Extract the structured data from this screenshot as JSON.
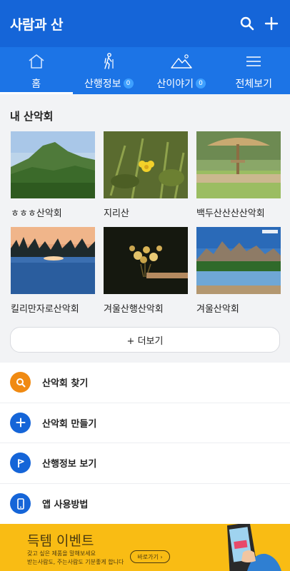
{
  "header": {
    "title": "사람과 산",
    "search_icon": "search-icon",
    "add_icon": "plus-icon"
  },
  "tabs": [
    {
      "label": "홈",
      "icon": "home-icon",
      "active": true
    },
    {
      "label": "산행정보",
      "badge": "0",
      "icon": "hiker-icon"
    },
    {
      "label": "산이야기",
      "badge": "0",
      "icon": "mountain-icon"
    },
    {
      "label": "전체보기",
      "icon": "menu-icon"
    }
  ],
  "my_clubs": {
    "title": "내 산악회",
    "items": [
      {
        "name": "ㅎㅎㅎ산악회",
        "thumb": "mountain-landscape"
      },
      {
        "name": "지리산",
        "thumb": "yellow-flower"
      },
      {
        "name": "백두산산산산악회",
        "thumb": "straw-parasol"
      },
      {
        "name": "킬리만자로산악회",
        "thumb": "palm-sunset"
      },
      {
        "name": "겨울산행산악회",
        "thumb": "flower-bouquet-night"
      },
      {
        "name": "겨울산악회",
        "thumb": "lake-mountains"
      }
    ],
    "more_label": "+ 더보기"
  },
  "menu": [
    {
      "label": "산악회 찾기",
      "icon": "search-icon",
      "color": "#f08a12"
    },
    {
      "label": "산악회 만들기",
      "icon": "plus-icon",
      "color": "#1565d8"
    },
    {
      "label": "산행정보 보기",
      "icon": "flag-icon",
      "color": "#1565d8"
    },
    {
      "label": "앱 사용방법",
      "icon": "phone-icon",
      "color": "#1565d8"
    }
  ],
  "banner": {
    "title": "득템 이벤트",
    "line1": "갖고 싶은 제품을 말해보세요",
    "line2": "받는사람도, 주는사람도 기분좋게 합니다",
    "cta": "바로가기 ›",
    "bg": "#f9bc14"
  },
  "colors": {
    "header": "#1565d8",
    "tabs": "#1c74e6",
    "accent": "#3ea0ff"
  }
}
